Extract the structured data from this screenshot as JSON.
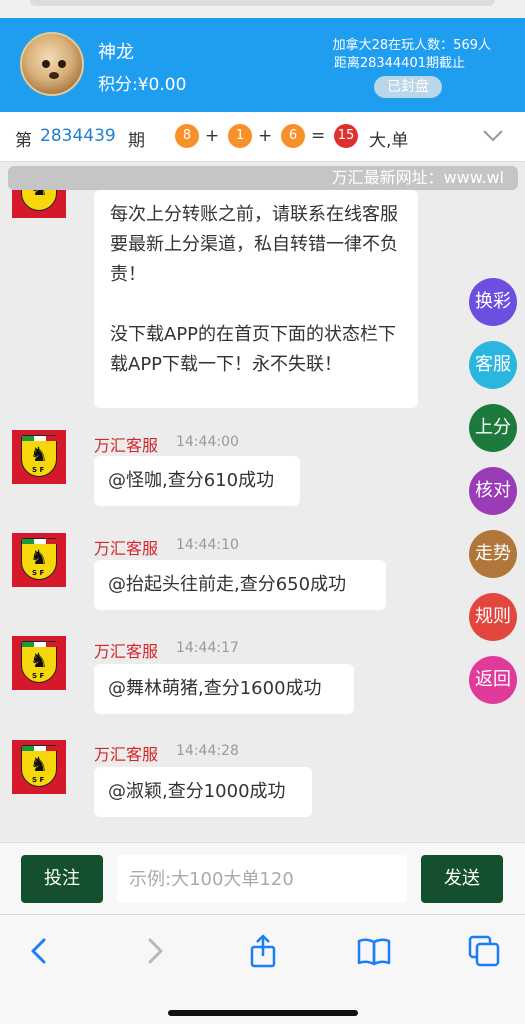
{
  "header": {
    "user_name": "神龙",
    "score": "积分:¥0.00",
    "info_line1": "加拿大28在玩人数：569人",
    "info_line2": "距离28344401期截止",
    "closed_label": "已封盘"
  },
  "draw": {
    "prefix": "第",
    "period": "2834439",
    "suffix": "期",
    "balls": [
      "8",
      "1",
      "6"
    ],
    "plus": "+",
    "equals": "=",
    "sum": "15",
    "result": "大,单"
  },
  "marquee_text": "万汇最新网址：www.wl",
  "notice": "每次上分转账之前，请联系在线客服要最新上分渠道，私自转错一律不负责！\n\n没下载APP的在首页下面的状态栏下载APP下载一下！永不失联！",
  "messages": [
    {
      "sender": "万汇客服",
      "time": "14:44:00",
      "text": "@怪咖,查分610成功"
    },
    {
      "sender": "万汇客服",
      "time": "14:44:10",
      "text": "@抬起头往前走,查分650成功"
    },
    {
      "sender": "万汇客服",
      "time": "14:44:17",
      "text": "@舞林萌猪,查分1600成功"
    },
    {
      "sender": "万汇客服",
      "time": "14:44:28",
      "text": "@淑颖,查分1000成功"
    }
  ],
  "side_buttons": [
    {
      "label": "换彩",
      "color": "#6c4fe0"
    },
    {
      "label": "客服",
      "color": "#2bb6e0"
    },
    {
      "label": "上分",
      "color": "#1c7a3c"
    },
    {
      "label": "核对",
      "color": "#9a3bb8"
    },
    {
      "label": "走势",
      "color": "#b0763a"
    },
    {
      "label": "规则",
      "color": "#e2463d"
    },
    {
      "label": "返回",
      "color": "#e03b9b"
    }
  ],
  "input_bar": {
    "bet_label": "投注",
    "placeholder": "示例:大100大单120",
    "send_label": "发送"
  },
  "browser_nav": {
    "icons": [
      "back-icon",
      "forward-icon",
      "share-icon",
      "bookmarks-icon",
      "tabs-icon"
    ]
  },
  "colors": {
    "header_bg": "#1f9ef0",
    "accent_blue": "#1f7fd0",
    "sender_red": "#d3262c",
    "button_green": "#15502e"
  }
}
